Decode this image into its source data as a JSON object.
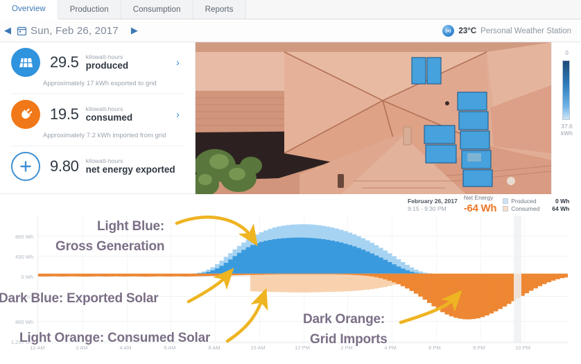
{
  "tabs": [
    {
      "label": "Overview",
      "active": true
    },
    {
      "label": "Production",
      "active": false
    },
    {
      "label": "Consumption",
      "active": false
    },
    {
      "label": "Reports",
      "active": false
    }
  ],
  "datebar": {
    "prev_icon": "chevron-left-icon",
    "calendar_icon": "calendar-icon",
    "date": "Sun, Feb 26, 2017",
    "next_icon": "chevron-right-icon"
  },
  "weather": {
    "icon": "broadcast-icon",
    "temperature": "23°C",
    "label": "Personal Weather Station"
  },
  "metrics": [
    {
      "icon": "solar-panel-icon",
      "value": "29.5",
      "unit": "kilowatt-hours",
      "name": "produced",
      "sub": "Approximately 17 kWh exported to grid",
      "chevron": "›"
    },
    {
      "icon": "plug-icon",
      "value": "19.5",
      "unit": "kilowatt-hours",
      "name": "consumed",
      "sub": "Approximately 7.2 kWh imported from grid",
      "chevron": "›"
    },
    {
      "icon": "plus-icon",
      "value": "9.80",
      "unit": "kilowatt-hours",
      "name": "net energy exported",
      "sub": "",
      "chevron": ""
    }
  ],
  "aerial": {
    "alt": "aerial-roof-solar-array",
    "legend_top": "0",
    "legend_bottom": "37.6\nkWh"
  },
  "tooltip": {
    "date": "February 26, 2017",
    "time": "9:15 - 9:30 PM",
    "net_label": "Net Energy",
    "net_value": "-64 Wh",
    "produced_label": "Produced",
    "produced_value": "0 Wh",
    "consumed_label": "Consumed",
    "consumed_value": "64 Wh"
  },
  "annotations": [
    {
      "line1": "Light Blue:",
      "line2": "Gross Generation"
    },
    {
      "line1": "Dark Blue: Exported Solar",
      "line2": ""
    },
    {
      "line1": "Light Orange: Consumed Solar",
      "line2": ""
    },
    {
      "line1": "Dark Orange:",
      "line2": "Grid Imports"
    }
  ],
  "colors": {
    "light_blue": "#a7d3f2",
    "dark_blue": "#3a9ade",
    "light_orange": "#f8d2af",
    "dark_orange": "#ed8733",
    "accent": "#3d77b5",
    "annotation": "#7b6f86",
    "arrow": "#eeb422"
  },
  "chart_data": {
    "type": "bar",
    "title": "",
    "xlabel": "",
    "ylabel": "Wh",
    "grid": true,
    "legend_position": "top-right",
    "ylim": [
      -1290,
      1075
    ],
    "y_ticks_positive": [
      "860 Wh",
      "430 Wh",
      "0 Wh"
    ],
    "y_ticks_negative": [
      "430 Wh",
      "860 Wh",
      "1,290 Wh"
    ],
    "x_ticks": [
      "12 AM",
      "2 AM",
      "4 AM",
      "6 AM",
      "8 AM",
      "10 AM",
      "12 PM",
      "2 PM",
      "4 PM",
      "6 PM",
      "8 PM",
      "10 PM"
    ],
    "interval_minutes": 15,
    "series": [
      {
        "name": "Gross Generation",
        "color": "#a7d3f2",
        "values": [
          0,
          0,
          0,
          0,
          0,
          0,
          0,
          0,
          0,
          0,
          0,
          0,
          0,
          0,
          0,
          0,
          0,
          0,
          0,
          0,
          0,
          0,
          0,
          0,
          0,
          0,
          0,
          0,
          0,
          0,
          0,
          0,
          0,
          0,
          0,
          5,
          18,
          40,
          75,
          120,
          175,
          240,
          310,
          380,
          450,
          515,
          575,
          630,
          680,
          725,
          765,
          800,
          830,
          855,
          875,
          890,
          900,
          908,
          912,
          915,
          915,
          912,
          906,
          898,
          886,
          872,
          856,
          836,
          814,
          788,
          760,
          728,
          694,
          656,
          616,
          572,
          526,
          478,
          428,
          376,
          322,
          268,
          214,
          162,
          114,
          72,
          40,
          18,
          6,
          0,
          0,
          0,
          0,
          0,
          0,
          0,
          0,
          0,
          0,
          0,
          0,
          0,
          0,
          0,
          0,
          0,
          0,
          0,
          0,
          0,
          0,
          0,
          0,
          0,
          0,
          0,
          0,
          0,
          0,
          0
        ]
      },
      {
        "name": "Exported Solar",
        "color": "#3a9ade",
        "values": [
          0,
          0,
          0,
          0,
          0,
          0,
          0,
          0,
          0,
          0,
          0,
          0,
          0,
          0,
          0,
          0,
          0,
          0,
          0,
          0,
          0,
          0,
          0,
          0,
          0,
          0,
          0,
          0,
          0,
          0,
          0,
          0,
          0,
          0,
          0,
          0,
          4,
          14,
          34,
          62,
          98,
          145,
          200,
          262,
          325,
          385,
          440,
          490,
          530,
          562,
          588,
          608,
          624,
          638,
          648,
          656,
          662,
          666,
          668,
          668,
          666,
          662,
          656,
          648,
          638,
          626,
          612,
          596,
          578,
          556,
          532,
          506,
          476,
          444,
          410,
          374,
          336,
          296,
          256,
          214,
          172,
          132,
          94,
          62,
          36,
          16,
          4,
          0,
          0,
          0,
          0,
          0,
          0,
          0,
          0,
          0,
          0,
          0,
          0,
          0,
          0,
          0,
          0,
          0,
          0,
          0,
          0,
          0,
          0,
          0,
          0,
          0,
          0,
          0,
          0,
          0,
          0,
          0,
          0,
          0
        ]
      },
      {
        "name": "Consumed Solar",
        "color": "#f8d2af",
        "values": [
          0,
          0,
          0,
          0,
          0,
          0,
          0,
          0,
          0,
          0,
          0,
          0,
          0,
          0,
          0,
          0,
          0,
          0,
          0,
          0,
          0,
          0,
          0,
          0,
          0,
          0,
          0,
          0,
          0,
          0,
          0,
          0,
          0,
          0,
          0,
          0,
          0,
          0,
          0,
          0,
          0,
          0,
          0,
          0,
          0,
          0,
          0,
          0,
          -330,
          -332,
          -334,
          -336,
          -338,
          -340,
          -342,
          -344,
          -346,
          -348,
          -350,
          -350,
          -350,
          -348,
          -346,
          -344,
          -342,
          -340,
          -338,
          -336,
          -334,
          -330,
          -326,
          -320,
          -314,
          -306,
          -298,
          -288,
          -276,
          -262,
          -246,
          -228,
          -208,
          -186,
          -162,
          -136,
          -110,
          -84,
          -58,
          -34,
          -14,
          0,
          0,
          0,
          0,
          0,
          0,
          0,
          0,
          0,
          0,
          0,
          0,
          0,
          0,
          0,
          0,
          0,
          0,
          0,
          0,
          0,
          0,
          0,
          0,
          0,
          0,
          0,
          0,
          0,
          0,
          0
        ]
      },
      {
        "name": "Grid Imports",
        "color": "#ed8733",
        "values": [
          -52,
          -54,
          -52,
          -50,
          -52,
          -54,
          -52,
          -50,
          -52,
          -54,
          -56,
          -54,
          -52,
          -50,
          -52,
          -54,
          -52,
          -50,
          -52,
          -54,
          -52,
          -50,
          -52,
          -54,
          -56,
          -54,
          -52,
          -50,
          -52,
          -54,
          -52,
          -50,
          -52,
          -54,
          -52,
          -50,
          -48,
          -46,
          -44,
          -42,
          -40,
          -38,
          -36,
          -34,
          -32,
          -30,
          -28,
          -26,
          -24,
          -22,
          -20,
          -18,
          -16,
          -14,
          -12,
          -12,
          -12,
          -12,
          -12,
          -12,
          -12,
          -12,
          -12,
          -12,
          -12,
          -12,
          -12,
          -14,
          -16,
          -18,
          -20,
          -24,
          -28,
          -34,
          -42,
          -52,
          -66,
          -84,
          -106,
          -132,
          -162,
          -196,
          -234,
          -276,
          -322,
          -372,
          -426,
          -484,
          -545,
          -606,
          -664,
          -715,
          -758,
          -792,
          -818,
          -836,
          -846,
          -848,
          -842,
          -828,
          -806,
          -776,
          -740,
          -700,
          -656,
          -610,
          -562,
          -512,
          -462,
          -412,
          -364,
          -318,
          -274,
          -232,
          -194,
          -160,
          -130,
          -104,
          -84,
          -72,
          -66,
          -64,
          -64,
          -64,
          -64,
          -64
        ]
      }
    ],
    "cursor": {
      "time": "9:15 - 9:30 PM",
      "net_wh": -64,
      "produced_wh": 0,
      "consumed_wh": 64
    }
  }
}
